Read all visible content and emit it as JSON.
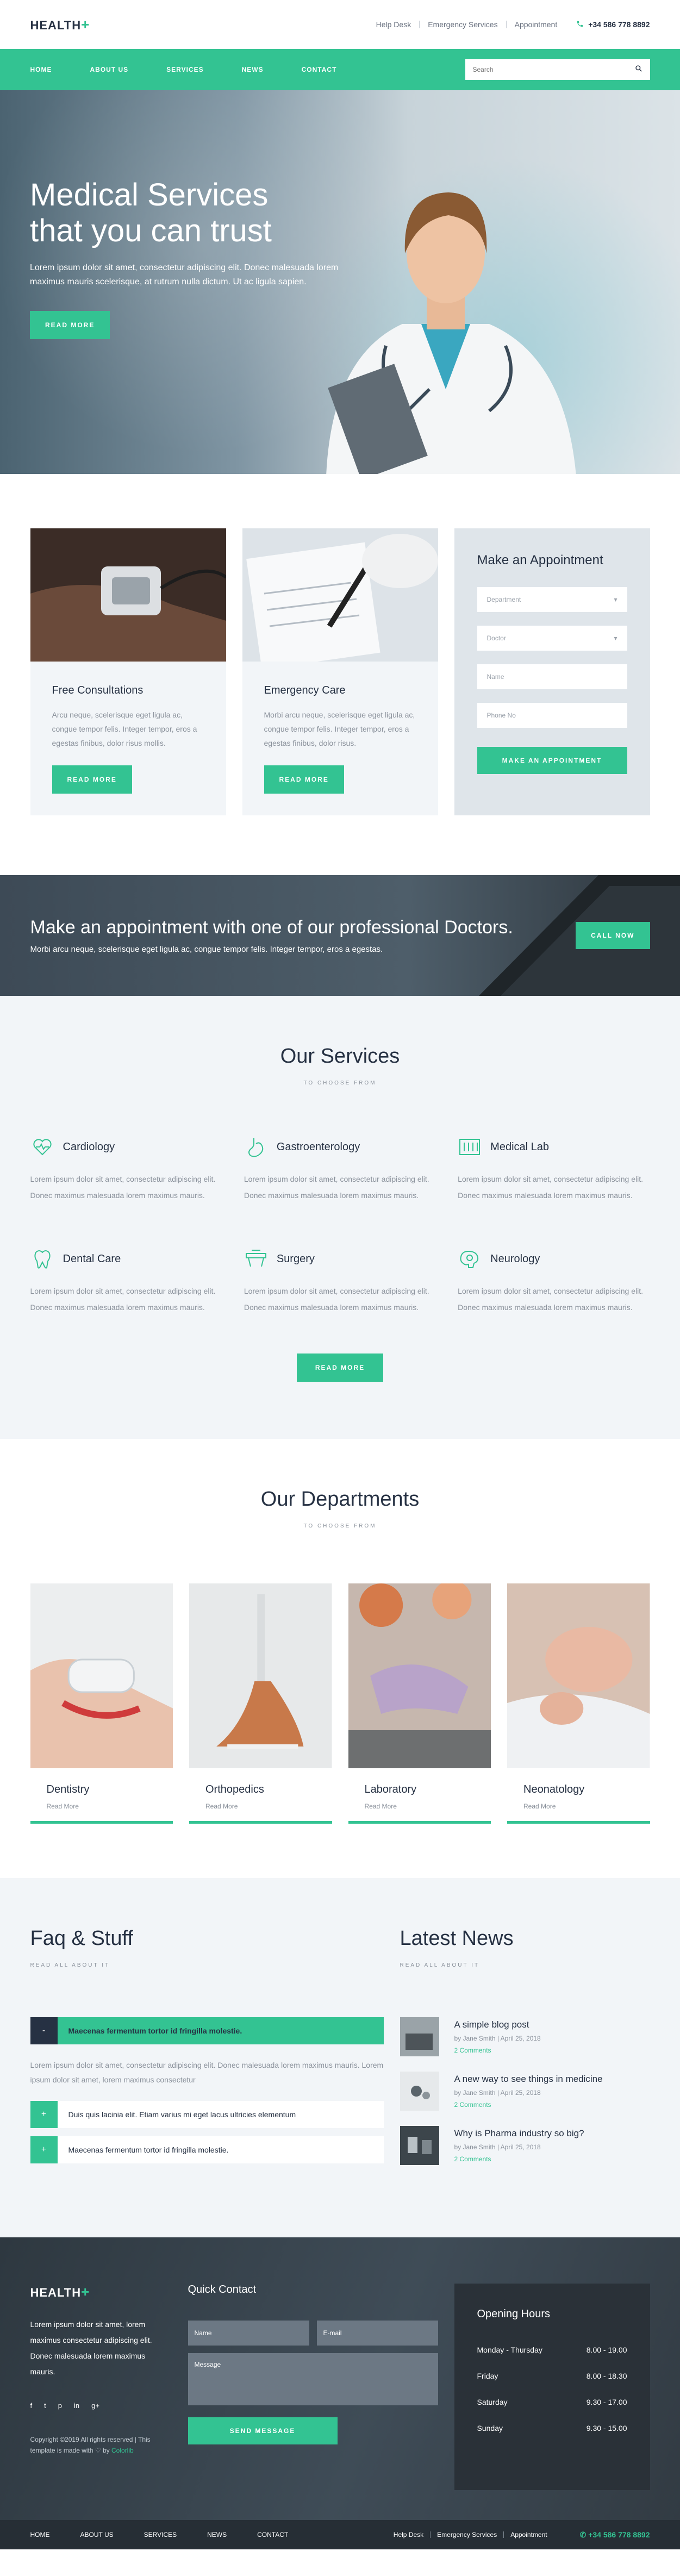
{
  "brand": {
    "name": "HEALTH",
    "plus": "+"
  },
  "topbar": {
    "links": [
      "Help Desk",
      "Emergency Services",
      "Appointment"
    ],
    "phone": "+34 586 778 8892"
  },
  "nav": {
    "items": [
      "HOME",
      "ABOUT US",
      "SERVICES",
      "NEWS",
      "CONTACT"
    ],
    "search_placeholder": "Search"
  },
  "hero": {
    "title_line1": "Medical Services",
    "title_line2": "that you can trust",
    "text": "Lorem ipsum dolor sit amet, consectetur adipiscing elit. Donec malesuada lorem maximus mauris scelerisque, at rutrum nulla dictum. Ut ac ligula sapien.",
    "button": "READ MORE"
  },
  "cards": [
    {
      "title": "Free Consultations",
      "text": "Arcu neque, scelerisque eget ligula ac, congue tempor felis. Integer tempor, eros a egestas finibus, dolor risus mollis.",
      "button": "READ MORE"
    },
    {
      "title": "Emergency Care",
      "text": "Morbi arcu neque, scelerisque eget ligula ac, congue tempor felis. Integer tempor, eros a egestas finibus, dolor risus.",
      "button": "READ MORE"
    }
  ],
  "appointment": {
    "title": "Make an Appointment",
    "department": "Department",
    "doctor": "Doctor",
    "name": "Name",
    "phone": "Phone No",
    "button": "MAKE AN APPOINTMENT"
  },
  "cta": {
    "title": "Make an appointment with one of our professional Doctors.",
    "text": "Morbi arcu neque, scelerisque eget ligula ac, congue tempor felis. Integer tempor, eros a egestas.",
    "button": "CALL NOW"
  },
  "services": {
    "title": "Our Services",
    "subtitle": "TO CHOOSE FROM",
    "button": "READ MORE",
    "items": [
      {
        "name": "Cardiology",
        "icon": "heart-icon",
        "text": "Lorem ipsum dolor sit amet, consectetur adipiscing elit. Donec maximus malesuada lorem maximus mauris."
      },
      {
        "name": "Gastroenterology",
        "icon": "stomach-icon",
        "text": "Lorem ipsum dolor sit amet, consectetur adipiscing elit. Donec maximus malesuada lorem maximus mauris."
      },
      {
        "name": "Medical Lab",
        "icon": "lab-icon",
        "text": "Lorem ipsum dolor sit amet, consectetur adipiscing elit. Donec maximus malesuada lorem maximus mauris."
      },
      {
        "name": "Dental Care",
        "icon": "tooth-icon",
        "text": "Lorem ipsum dolor sit amet, consectetur adipiscing elit. Donec maximus malesuada lorem maximus mauris."
      },
      {
        "name": "Surgery",
        "icon": "surgery-bed-icon",
        "text": "Lorem ipsum dolor sit amet, consectetur adipiscing elit. Donec maximus malesuada lorem maximus mauris."
      },
      {
        "name": "Neurology",
        "icon": "brain-icon",
        "text": "Lorem ipsum dolor sit amet, consectetur adipiscing elit. Donec maximus malesuada lorem maximus mauris."
      }
    ]
  },
  "departments": {
    "title": "Our Departments",
    "subtitle": "TO CHOOSE FROM",
    "items": [
      {
        "name": "Dentistry",
        "link": "Read More"
      },
      {
        "name": "Orthopedics",
        "link": "Read More"
      },
      {
        "name": "Laboratory",
        "link": "Read More"
      },
      {
        "name": "Neonatology",
        "link": "Read More"
      }
    ]
  },
  "faq": {
    "title": "Faq & Stuff",
    "subtitle": "READ ALL ABOUT IT",
    "items": [
      {
        "q": "Maecenas fermentum tortor id fringilla molestie.",
        "open": true,
        "toggle": "-"
      },
      {
        "q": "Duis quis lacinia elit. Etiam varius mi eget lacus ultricies elementum",
        "open": false,
        "toggle": "+"
      },
      {
        "q": "Maecenas fermentum tortor id fringilla molestie.",
        "open": false,
        "toggle": "+"
      }
    ],
    "answer": "Lorem ipsum dolor sit amet, consectetur adipiscing elit. Donec malesuada lorem maximus mauris. Lorem ipsum dolor sit amet, lorem maximus consectetur"
  },
  "news": {
    "title": "Latest News",
    "subtitle": "READ ALL ABOUT IT",
    "items": [
      {
        "title": "A simple blog post",
        "meta": "by Jane Smith | April 25, 2018",
        "comments": "2 Comments"
      },
      {
        "title": "A new way to see things in medicine",
        "meta": "by Jane Smith | April 25, 2018",
        "comments": "2 Comments"
      },
      {
        "title": "Why is Pharma industry so big?",
        "meta": "by Jane Smith | April 25, 2018",
        "comments": "2 Comments"
      }
    ]
  },
  "footer": {
    "about": "Lorem ipsum dolor sit amet, lorem maximus consectetur adipiscing elit. Donec malesuada lorem maximus mauris.",
    "social": [
      "f",
      "t",
      "p",
      "in",
      "g+"
    ],
    "copyright": "Copyright ©2019 All rights reserved | This template is made with ♡ by",
    "copyright_link": "Colorlib",
    "quick_title": "Quick Contact",
    "name_ph": "Name",
    "email_ph": "E-mail",
    "message_ph": "Message",
    "send": "SEND MESSAGE",
    "hours_title": "Opening Hours",
    "hours": [
      {
        "day": "Monday - Thursday",
        "time": "8.00 - 19.00"
      },
      {
        "day": "Friday",
        "time": "8.00 - 18.30"
      },
      {
        "day": "Saturday",
        "time": "9.30 - 17.00"
      },
      {
        "day": "Sunday",
        "time": "9.30 - 15.00"
      }
    ]
  },
  "bottombar": {
    "menu": [
      "HOME",
      "ABOUT US",
      "SERVICES",
      "NEWS",
      "CONTACT"
    ],
    "links": [
      "Help Desk",
      "Emergency Services",
      "Appointment"
    ],
    "phone": "+34 586 778 8892"
  },
  "colors": {
    "accent": "#33c392",
    "dark": "#263143",
    "light_bg": "#f2f5f8"
  }
}
